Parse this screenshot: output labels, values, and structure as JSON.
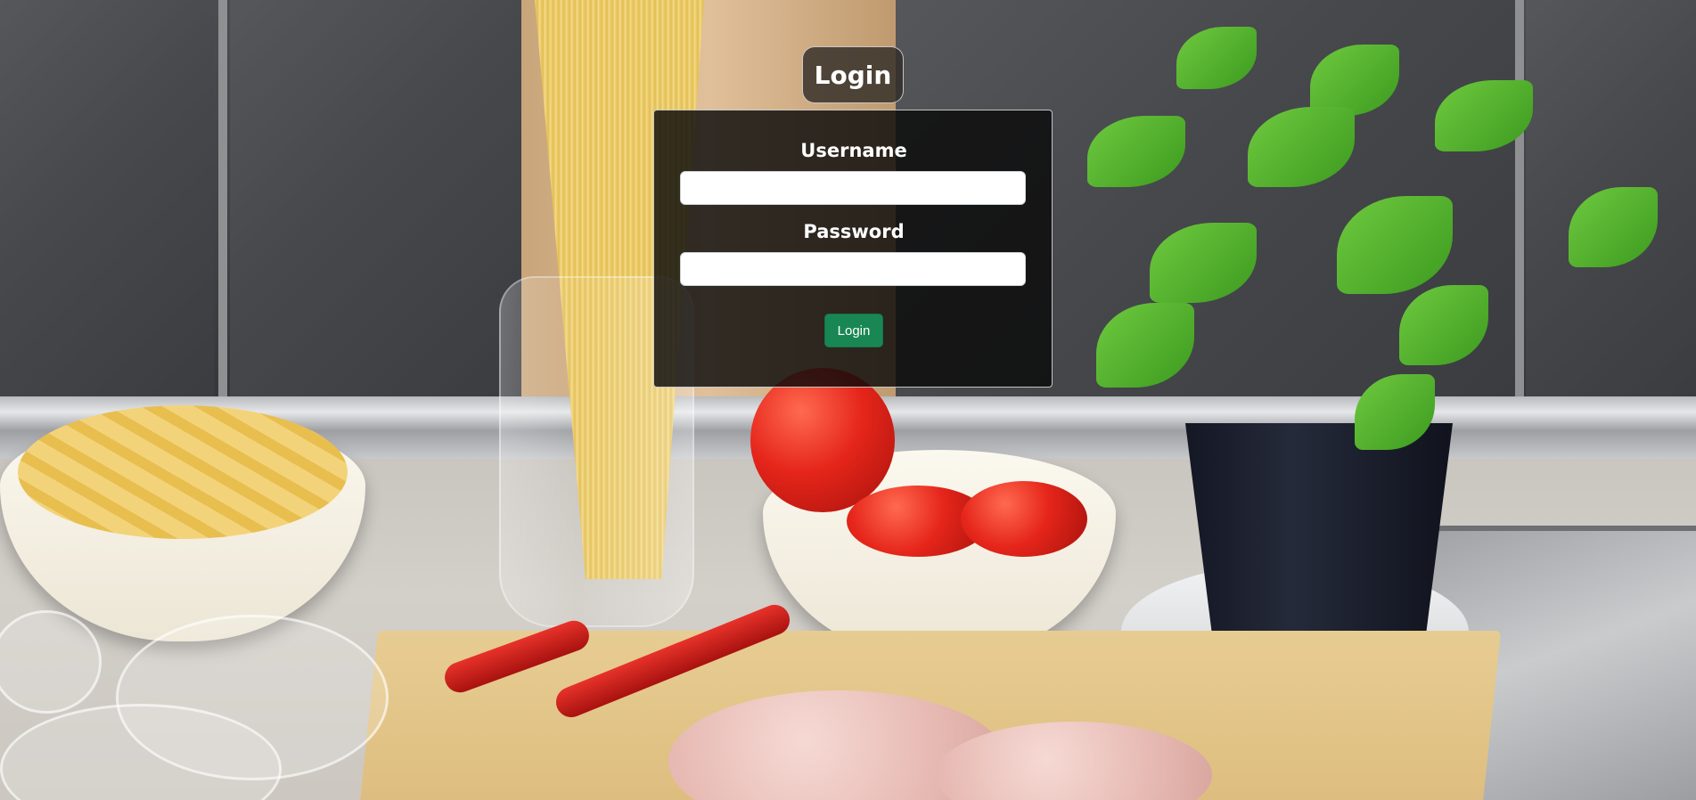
{
  "page_title": "Login",
  "form": {
    "username_label": "Username",
    "username_value": "",
    "password_label": "Password",
    "password_value": "",
    "submit_label": "Login"
  },
  "colors": {
    "submit_button": "#198754",
    "card_background": "rgba(10,10,10,0.82)",
    "title_background": "rgba(50,45,40,0.82)"
  },
  "background": {
    "description_icon": "kitchen-ingredients-photo"
  }
}
